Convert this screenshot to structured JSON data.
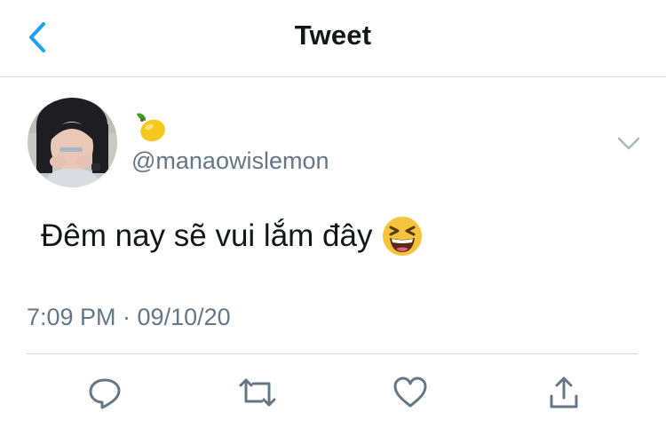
{
  "header": {
    "title": "Tweet",
    "back_icon": "chevron-left-icon"
  },
  "tweet": {
    "display_name_emoji": "lemon",
    "handle": "@manaowislemon",
    "text": "Đêm nay sẽ vui lắm đây",
    "text_emoji": "grinning-squinting-face",
    "timestamp": "7:09 PM · 09/10/20"
  },
  "actions": [
    "reply-icon",
    "retweet-icon",
    "like-icon",
    "share-icon"
  ],
  "colors": {
    "accent": "#1da1f2",
    "text": "#14171a",
    "secondary_text": "#657786",
    "divider": "#d6d9dc"
  }
}
